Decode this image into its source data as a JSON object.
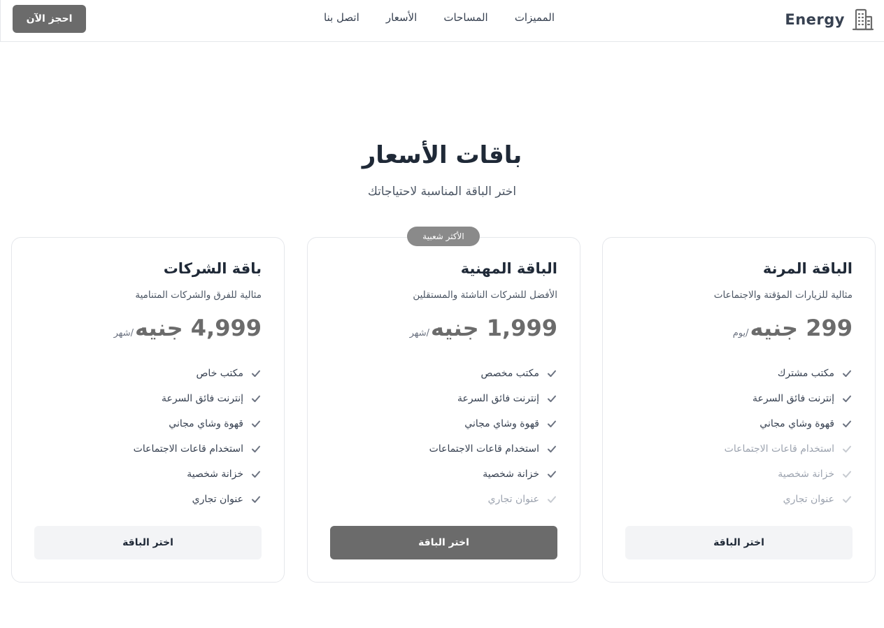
{
  "header": {
    "brand": "Energy",
    "brand_icon": "building-icon",
    "nav": [
      "المميزات",
      "المساحات",
      "الأسعار",
      "اتصل بنا"
    ],
    "cta": "احجز الآن"
  },
  "section": {
    "title": "باقات الأسعار",
    "subtitle": "اختر الباقة المناسبة لاحتياجاتك"
  },
  "badge": "الأكثر شعبية",
  "plans": [
    {
      "name": "الباقة المرنة",
      "desc": "مثالية للزيارات المؤقتة والاجتماعات",
      "price": "299 جنيه",
      "period": "/يوم",
      "features": [
        {
          "label": "مكتب مشترك",
          "included": true
        },
        {
          "label": "إنترنت فائق السرعة",
          "included": true
        },
        {
          "label": "قهوة وشاي مجاني",
          "included": true
        },
        {
          "label": "استخدام قاعات الاجتماعات",
          "included": false
        },
        {
          "label": "خزانة شخصية",
          "included": false
        },
        {
          "label": "عنوان تجاري",
          "included": false
        }
      ],
      "button": "اختر الباقة"
    },
    {
      "name": "الباقة المهنية",
      "desc": "الأفضل للشركات الناشئة والمستقلين",
      "price": "1,999 جنيه",
      "period": "/شهر",
      "features": [
        {
          "label": "مكتب مخصص",
          "included": true
        },
        {
          "label": "إنترنت فائق السرعة",
          "included": true
        },
        {
          "label": "قهوة وشاي مجاني",
          "included": true
        },
        {
          "label": "استخدام قاعات الاجتماعات",
          "included": true
        },
        {
          "label": "خزانة شخصية",
          "included": true
        },
        {
          "label": "عنوان تجاري",
          "included": false
        }
      ],
      "button": "اختر الباقة"
    },
    {
      "name": "باقة الشركات",
      "desc": "مثالية للفرق والشركات المتنامية",
      "price": "4,999 جنيه",
      "period": "/شهر",
      "features": [
        {
          "label": "مكتب خاص",
          "included": true
        },
        {
          "label": "إنترنت فائق السرعة",
          "included": true
        },
        {
          "label": "قهوة وشاي مجاني",
          "included": true
        },
        {
          "label": "استخدام قاعات الاجتماعات",
          "included": true
        },
        {
          "label": "خزانة شخصية",
          "included": true
        },
        {
          "label": "عنوان تجاري",
          "included": true
        }
      ],
      "button": "اختر الباقة"
    }
  ],
  "colors": {
    "accent": "#6b6b6b",
    "text": "#1f2937",
    "muted": "#9ca3af",
    "border": "#e5e7eb"
  }
}
